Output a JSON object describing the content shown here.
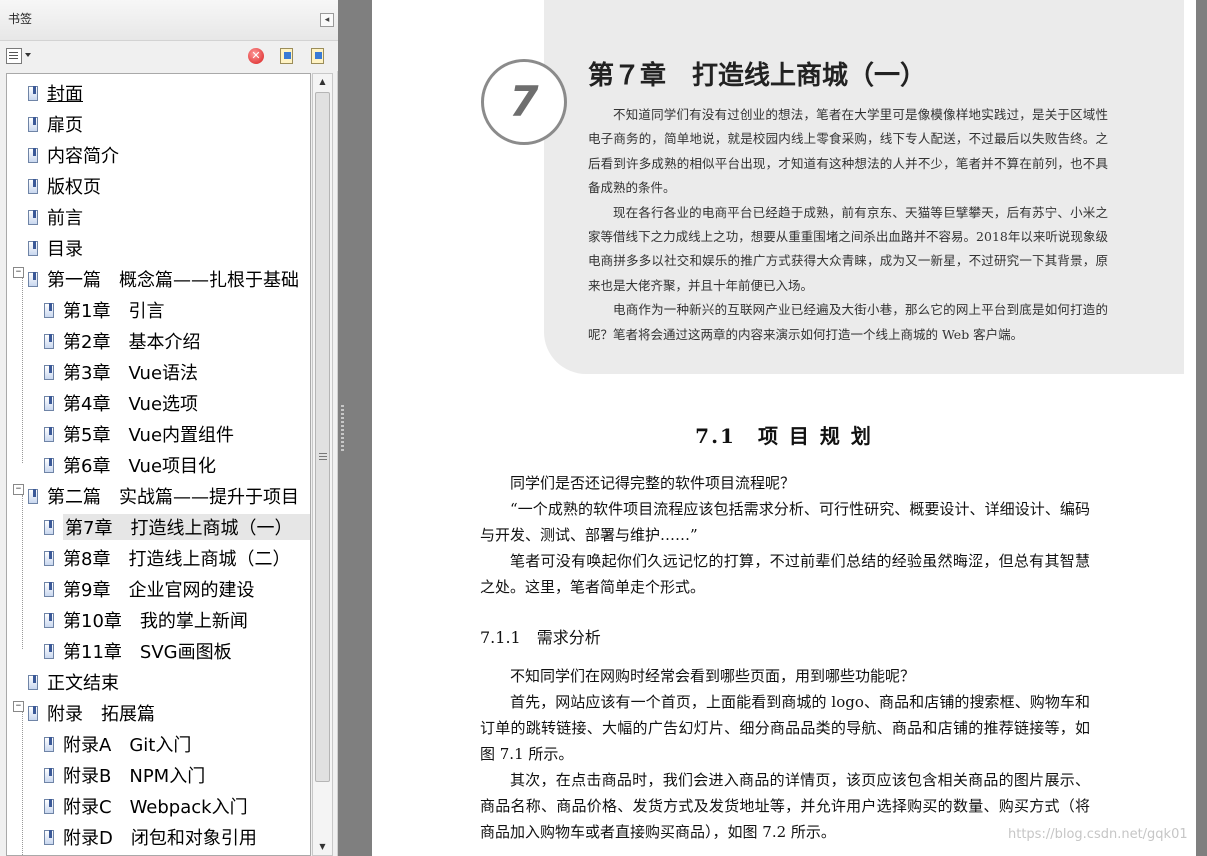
{
  "sidebar": {
    "title": "书签",
    "collapse_icon": "◂",
    "toolbar": {
      "options_icon": "options-menu-icon",
      "delete_icon": "✕",
      "new_icon": "new-bookmark-icon",
      "expand_icon": "expand-bookmark-icon"
    },
    "bookmarks": [
      {
        "label": "封面"
      },
      {
        "label": "扉页"
      },
      {
        "label": "内容简介"
      },
      {
        "label": "版权页"
      },
      {
        "label": "前言"
      },
      {
        "label": "目录"
      },
      {
        "label": "第一篇　概念篇——扎根于基础",
        "toggle": "−"
      },
      {
        "label": "第1章　引言"
      },
      {
        "label": "第2章　基本介绍"
      },
      {
        "label": "第3章　Vue语法"
      },
      {
        "label": "第4章　Vue选项"
      },
      {
        "label": "第5章　Vue内置组件"
      },
      {
        "label": "第6章　Vue项目化"
      },
      {
        "label": "第二篇　实战篇——提升于项目",
        "toggle": "−"
      },
      {
        "label": "第7章　打造线上商城（一）"
      },
      {
        "label": "第8章　打造线上商城（二）"
      },
      {
        "label": "第9章　企业官网的建设"
      },
      {
        "label": "第10章　我的掌上新闻"
      },
      {
        "label": "第11章　SVG画图板"
      },
      {
        "label": "正文结束"
      },
      {
        "label": "附录　拓展篇",
        "toggle": "−"
      },
      {
        "label": "附录A　Git入门"
      },
      {
        "label": "附录B　NPM入门"
      },
      {
        "label": "附录C　Webpack入门"
      },
      {
        "label": "附录D　闭包和对象引用"
      }
    ],
    "scroll": {
      "up": "▲",
      "down": "▼"
    }
  },
  "page": {
    "chapter_number": "7",
    "chapter_title": "第７章　打造线上商城（一）",
    "intro": [
      "不知道同学们有没有过创业的想法，笔者在大学里可是像模像样地实践过，是关于区域性电子商务的，简单地说，就是校园内线上零食采购，线下专人配送，不过最后以失败告终。之后看到许多成熟的相似平台出现，才知道有这种想法的人并不少，笔者并不算在前列，也不具备成熟的条件。",
      "现在各行各业的电商平台已经趋于成熟，前有京东、天猫等巨擘攀天，后有苏宁、小米之家等借线下之力成线上之功，想要从重重围堵之间杀出血路并不容易。2018年以来听说现象级电商拼多多以社交和娱乐的推广方式获得大众青睐，成为又一新星，不过研究一下其背景，原来也是大佬齐聚，并且十年前便已入场。",
      "电商作为一种新兴的互联网产业已经遍及大街小巷，那么它的网上平台到底是如何打造的呢？笔者将会通过这两章的内容来演示如何打造一个线上商城的 Web 客户端。"
    ],
    "section_title": "7.1　项 目 规 划",
    "section_paragraphs": [
      "同学们是否还记得完整的软件项目流程呢？",
      "“一个成熟的软件项目流程应该包括需求分析、可行性研究、概要设计、详细设计、编码与开发、测试、部署与维护……”",
      "笔者可没有唤起你们久远记忆的打算，不过前辈们总结的经验虽然晦涩，但总有其智慧之处。这里，笔者简单走个形式。"
    ],
    "subsection_title": "7.1.1　需求分析",
    "subsection_paragraphs": [
      "不知同学们在网购时经常会看到哪些页面，用到哪些功能呢？",
      "首先，网站应该有一个首页，上面能看到商城的 logo、商品和店铺的搜索框、购物车和订单的跳转链接、大幅的广告幻灯片、细分商品品类的导航、商品和店铺的推荐链接等，如图 7.1 所示。",
      "其次，在点击商品时，我们会进入商品的详情页，该页应该包含相关商品的图片展示、商品名称、商品价格、发货方式及发货地址等，并允许用户选择购买的数量、购买方式（将商品加入购物车或者直接购买商品），如图 7.2 所示。"
    ]
  },
  "watermark": "https://blog.csdn.net/gqk01"
}
